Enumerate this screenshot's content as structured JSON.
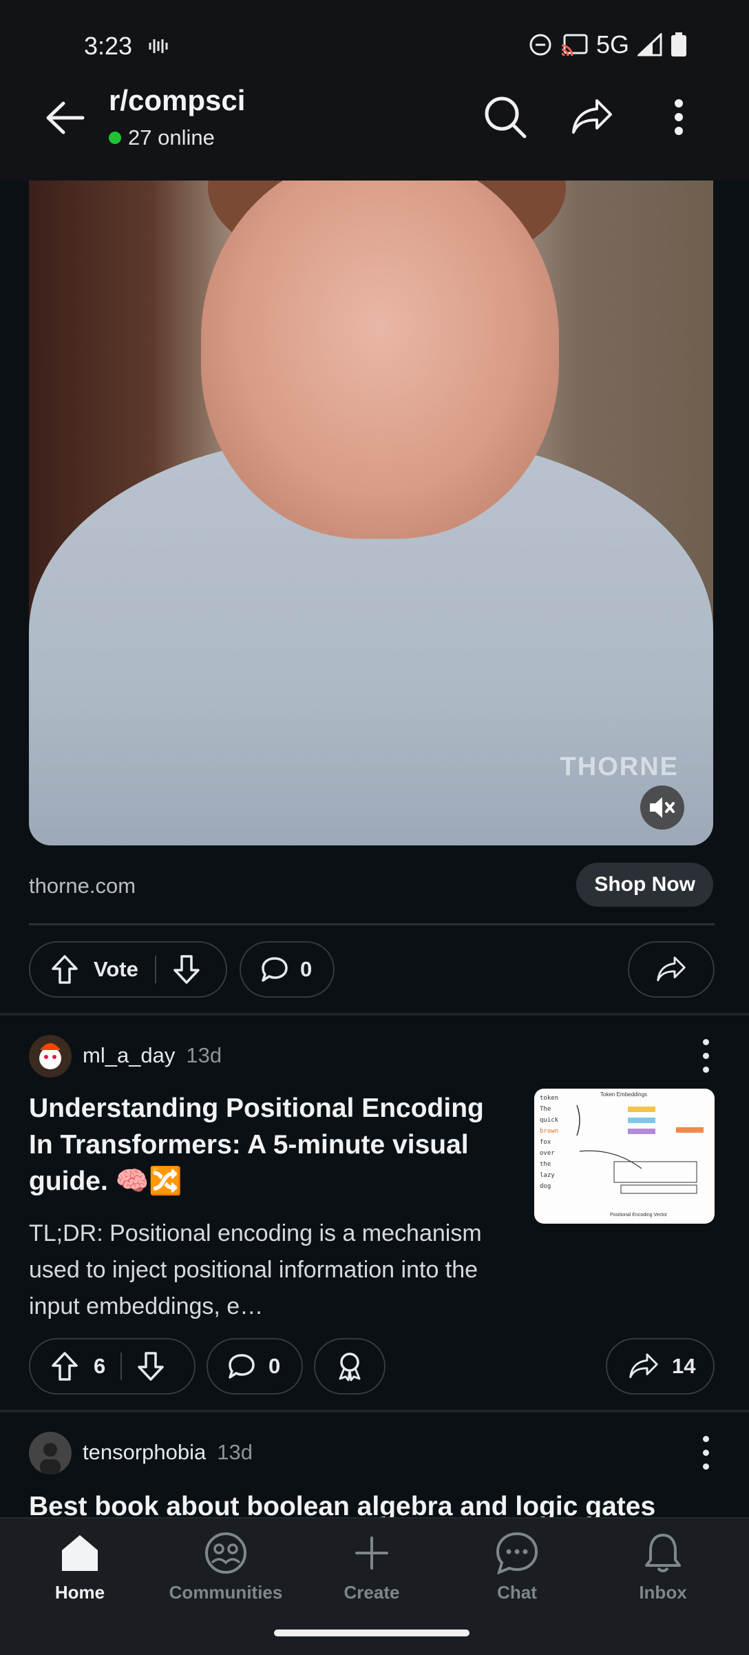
{
  "status_bar": {
    "time": "3:23",
    "network": "5G"
  },
  "header": {
    "subreddit": "r/compsci",
    "online": "27 online"
  },
  "ad": {
    "watermark": "THORNE",
    "domain": "thorne.com",
    "cta": "Shop Now",
    "actions": {
      "vote_label": "Vote",
      "comments": "0"
    }
  },
  "posts": [
    {
      "author": "ml_a_day",
      "age": "13d",
      "title": "Understanding Positional Encoding In Transformers: A 5-minute visual guide. 🧠🔀",
      "body": "TL;DR: Positional encoding is a mechanism used to inject positional information into the input embeddings, e…",
      "votes": "6",
      "comments": "0",
      "shares": "14",
      "thumb_labels": [
        "token",
        "The",
        "quick",
        "brown",
        "fox",
        "over",
        "the",
        "lazy",
        "dog",
        "Token Embeddings",
        "Positional Encoding Vector"
      ]
    },
    {
      "author": "tensorphobia",
      "age": "13d",
      "title": "Best book about boolean algebra and logic gates"
    }
  ],
  "nav": [
    {
      "label": "Home",
      "icon": "home-icon",
      "active": true
    },
    {
      "label": "Communities",
      "icon": "communities-icon"
    },
    {
      "label": "Create",
      "icon": "plus-icon"
    },
    {
      "label": "Chat",
      "icon": "chat-icon"
    },
    {
      "label": "Inbox",
      "icon": "bell-icon"
    }
  ],
  "colors": {
    "background": "#0b1014",
    "online_dot": "#22c232",
    "pill_border": "#333a40"
  }
}
